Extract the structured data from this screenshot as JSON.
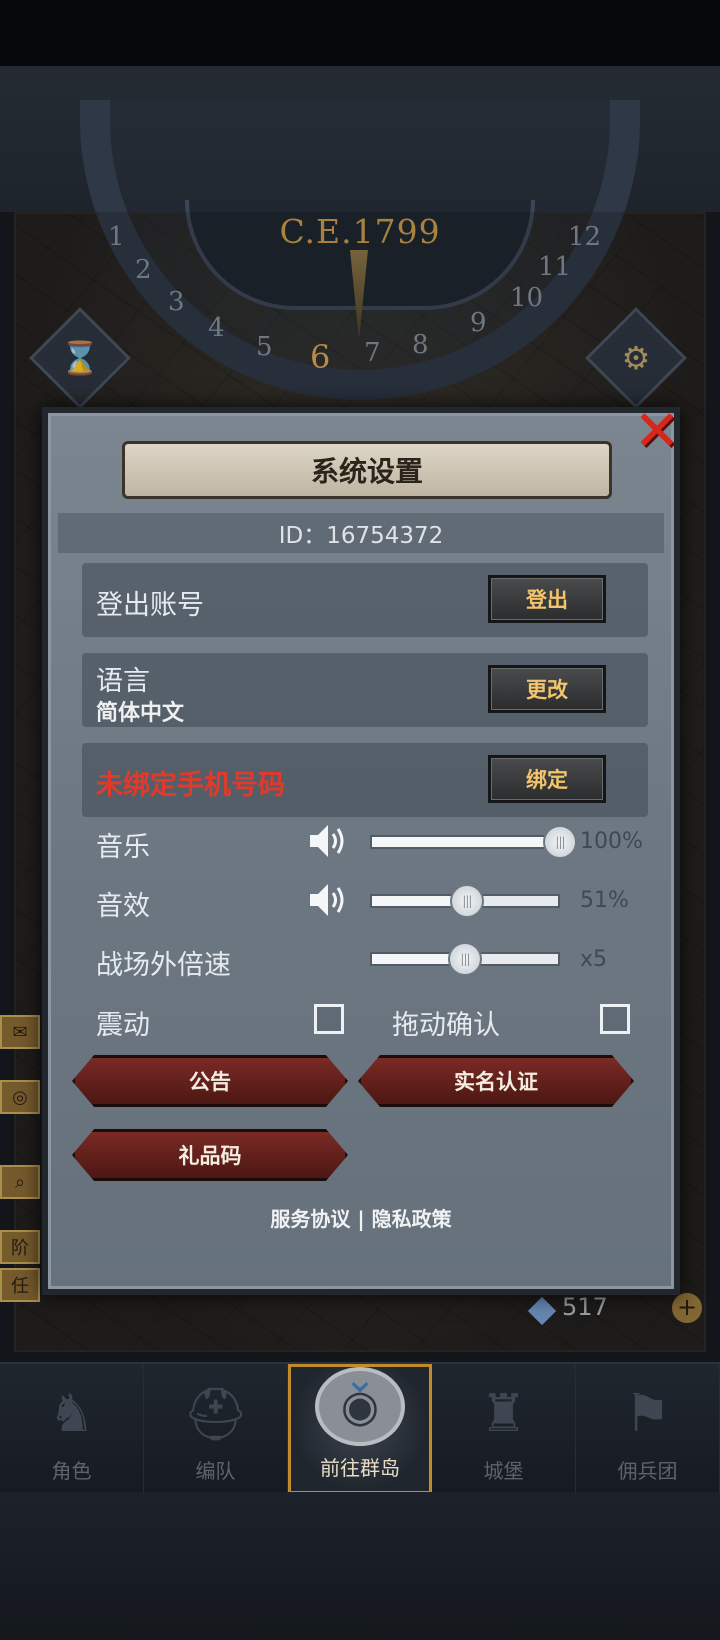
{
  "header": {
    "era": "C.E.1799",
    "dial_numbers": [
      "1",
      "2",
      "3",
      "4",
      "5",
      "6",
      "7",
      "8",
      "9",
      "10",
      "11",
      "12"
    ],
    "active_number": "6"
  },
  "background": {
    "resource_value": "517",
    "side_letters": [
      "阶",
      "任"
    ]
  },
  "dialog": {
    "title": "系统设置",
    "id_text": "ID：16754372",
    "logout": {
      "label": "登出账号",
      "button": "登出"
    },
    "language": {
      "label": "语言",
      "value": "简体中文",
      "button": "更改"
    },
    "phone": {
      "label": "未绑定手机号码",
      "button": "绑定",
      "label_color": "#e23a2a"
    },
    "music": {
      "label": "音乐",
      "value_text": "100%",
      "level": 1.0
    },
    "sfx": {
      "label": "音效",
      "value_text": "51%",
      "level": 0.51
    },
    "battle_speed": {
      "label": "战场外倍速",
      "value_text": "x5",
      "level": 0.5
    },
    "vibration": {
      "label": "震动",
      "checked": false
    },
    "drag_confirm": {
      "label": "拖动确认",
      "checked": false
    },
    "buttons": {
      "notice": "公告",
      "real_name": "实名认证",
      "gift_code": "礼品码"
    },
    "footer": {
      "service": "服务协议",
      "separator": "|",
      "privacy": "隐私政策"
    }
  },
  "bottom_nav": {
    "items": [
      {
        "label": "角色",
        "icon": "knight-icon"
      },
      {
        "label": "编队",
        "icon": "helmet-icon"
      },
      {
        "label": "前往群岛",
        "icon": "globe-icon",
        "active": true
      },
      {
        "label": "城堡",
        "icon": "castle-icon"
      },
      {
        "label": "佣兵团",
        "icon": "banner-icon"
      }
    ]
  },
  "colors": {
    "accent_gold": "#c28a2a",
    "close_red": "#d9261c",
    "button_red": "#7a2a24"
  }
}
